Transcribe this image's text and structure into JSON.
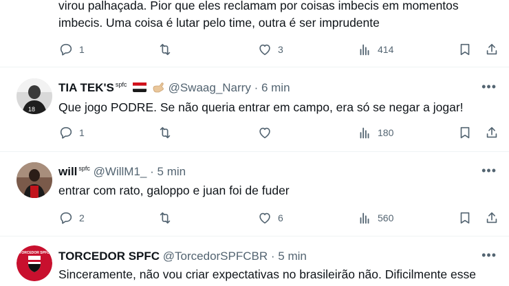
{
  "tweets": [
    {
      "text_lines": [
        "virou palhaçada. Pior que eles reclamam por coisas imbecis em momentos",
        "imbecis. Uma coisa é lutar pelo time, outra é ser imprudente"
      ],
      "replies": "1",
      "retweets": "",
      "likes": "3",
      "views": "414"
    },
    {
      "name": "TIA TEK'S",
      "badge": "spfc",
      "handle": "@Swaag_Narry",
      "sep": "·",
      "time": "6 min",
      "text": "Que jogo PODRE. Se não queria entrar em campo, era só se negar a jogar!",
      "replies": "1",
      "retweets": "",
      "likes": "",
      "views": "180",
      "more": "•••"
    },
    {
      "name": "will",
      "badge": "spfc",
      "handle": "@WillM1_",
      "sep": "·",
      "time": "5 min",
      "text": "entrar com rato, galoppo e juan foi de fuder",
      "replies": "2",
      "retweets": "",
      "likes": "6",
      "views": "560",
      "more": "•••"
    },
    {
      "name": "TORCEDOR SPFC",
      "handle": "@TorcedorSPFCBR",
      "sep": "·",
      "time": "5 min",
      "text": "Sinceramente, não vou criar expectativas no brasileirão não. Dificilmente esse",
      "more": "•••",
      "avatar_text": "TORCEDOR SPFC"
    }
  ],
  "colors": {
    "text": "#0f1419",
    "muted": "#536471",
    "divider": "#eff3f4"
  }
}
